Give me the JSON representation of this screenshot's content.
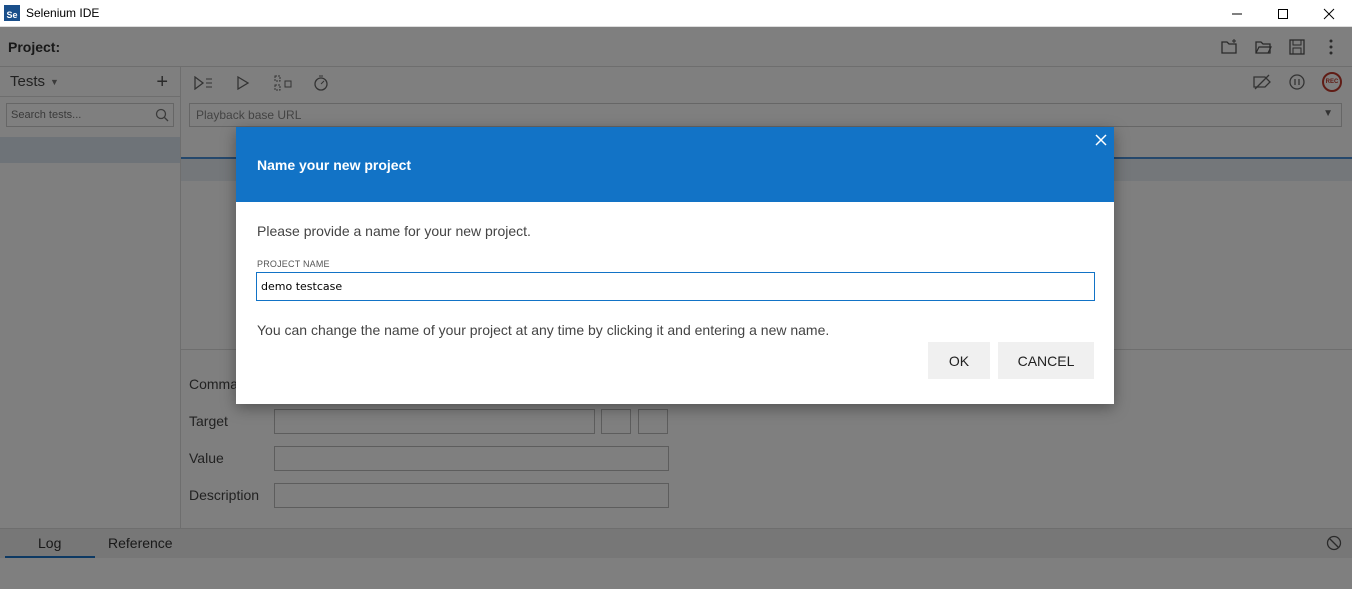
{
  "window": {
    "title": "Selenium IDE",
    "logo_text": "Se"
  },
  "project": {
    "label": "Project:"
  },
  "sidebar": {
    "tests_title": "Tests",
    "search_placeholder": "Search tests..."
  },
  "toolbar": {
    "base_url_placeholder": "Playback base URL"
  },
  "editor": {
    "command_label": "Command",
    "target_label": "Target",
    "value_label": "Value",
    "description_label": "Description"
  },
  "bottom_tabs": {
    "log": "Log",
    "reference": "Reference"
  },
  "dialog": {
    "title": "Name your new project",
    "prompt": "Please provide a name for your new project.",
    "field_label": "PROJECT NAME",
    "field_value": "demo testcase",
    "hint": "You can change the name of your project at any time by clicking it and entering a new name.",
    "ok_label": "OK",
    "cancel_label": "CANCEL"
  },
  "colors": {
    "dialog_header": "#1273c6",
    "rec": "#c0392b"
  }
}
